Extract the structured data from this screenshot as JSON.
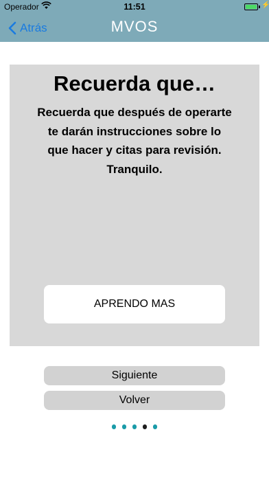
{
  "status_bar": {
    "carrier": "Operador",
    "time": "11:51",
    "battery_level": 1.0
  },
  "nav": {
    "back_label": "Atrás",
    "title": "MVOS"
  },
  "card": {
    "title": "Recuerda que…",
    "body": "Recuerda que después de operarte te darán instrucciones sobre lo que hacer y citas para revisión. Tranquilo.",
    "learn_more_label": "APRENDO MAS"
  },
  "buttons": {
    "next_label": "Siguiente",
    "back_label": "Volver"
  },
  "pager": {
    "total": 5,
    "current_index": 3
  },
  "colors": {
    "nav_background": "#7eaab8",
    "back_link": "#1a7be0",
    "card_background": "#d8d8d8",
    "button_background": "#d2d2d2",
    "dot_inactive": "#1a9ba8",
    "dot_active": "#1e1e1e"
  },
  "icons": {
    "wifi": "wifi-icon",
    "battery": "battery-icon",
    "back": "chevron-left-icon"
  }
}
